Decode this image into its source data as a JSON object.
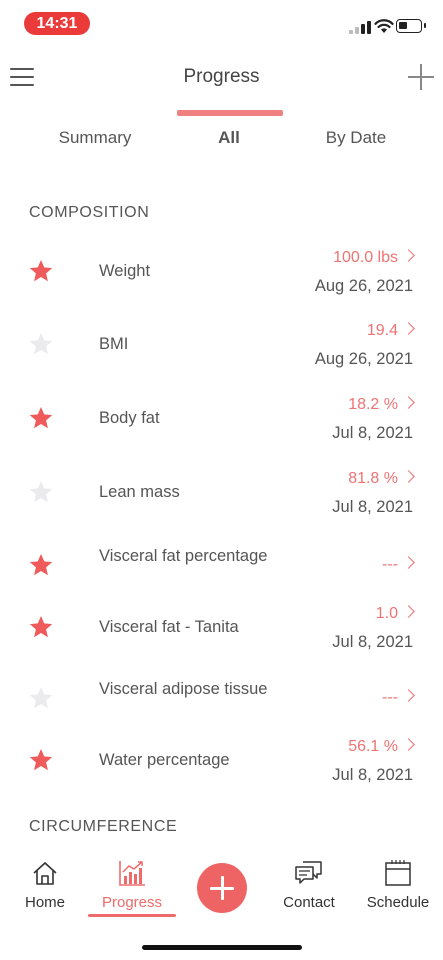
{
  "status_bar": {
    "time": "14:31"
  },
  "header": {
    "title": "Progress"
  },
  "tabs": [
    {
      "label": "Summary",
      "active": false
    },
    {
      "label": "All",
      "active": true
    },
    {
      "label": "By Date",
      "active": false
    }
  ],
  "sections": {
    "composition": "COMPOSITION",
    "circumference": "CIRCUMFERENCE"
  },
  "colors": {
    "accent": "#ee6464",
    "star_active": "#ef5a5a",
    "star_inactive": "#ebebee",
    "value_text": "#ef7373"
  },
  "metrics": [
    {
      "label": "Weight",
      "starred": true,
      "value": "100.0 lbs",
      "date": "Aug 26, 2021"
    },
    {
      "label": "BMI",
      "starred": false,
      "value": "19.4",
      "date": "Aug 26, 2021"
    },
    {
      "label": "Body fat",
      "starred": true,
      "value": "18.2 %",
      "date": "Jul 8, 2021"
    },
    {
      "label": "Lean mass",
      "starred": false,
      "value": "81.8 %",
      "date": "Jul 8, 2021"
    },
    {
      "label": "Visceral fat percentage",
      "starred": true,
      "value": "---",
      "date": ""
    },
    {
      "label": "Visceral fat - Tanita",
      "starred": true,
      "value": "1.0",
      "date": "Jul 8, 2021"
    },
    {
      "label": "Visceral adipose tissue",
      "starred": false,
      "value": "---",
      "date": ""
    },
    {
      "label": "Water percentage",
      "starred": true,
      "value": "56.1 %",
      "date": "Jul 8, 2021"
    }
  ],
  "bottom_nav": [
    {
      "label": "Home",
      "icon": "home-icon",
      "active": false
    },
    {
      "label": "Progress",
      "icon": "chart-icon",
      "active": true
    },
    {
      "label": "Contact",
      "icon": "chat-icon",
      "active": false
    },
    {
      "label": "Schedule",
      "icon": "calendar-icon",
      "active": false
    }
  ]
}
